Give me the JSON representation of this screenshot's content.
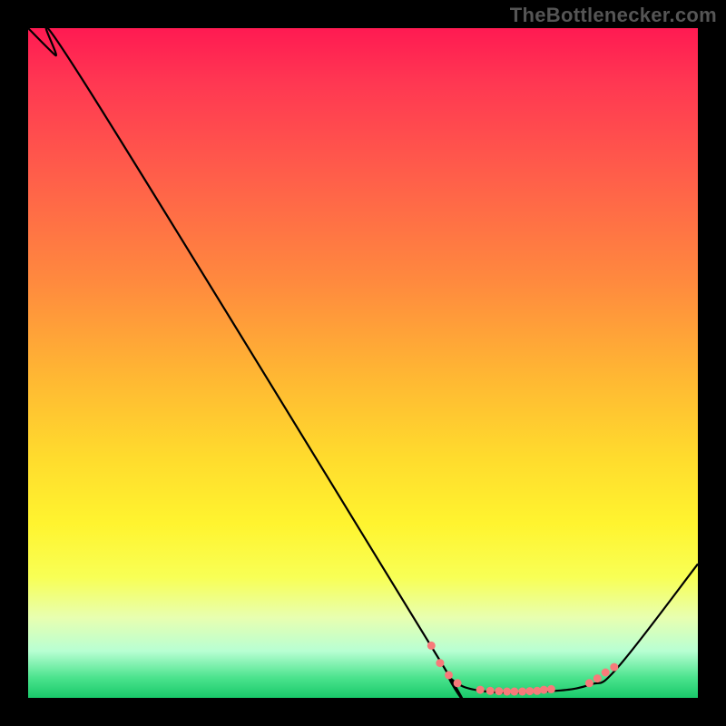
{
  "attribution": "TheBottlenecker.com",
  "chart_data": {
    "type": "line",
    "title": "",
    "xlabel": "",
    "ylabel": "",
    "xlim": [
      0,
      100
    ],
    "ylim": [
      0,
      100
    ],
    "curve": [
      {
        "x": 0,
        "y": 100
      },
      {
        "x": 4,
        "y": 96
      },
      {
        "x": 8,
        "y": 92.5
      },
      {
        "x": 60,
        "y": 8
      },
      {
        "x": 63,
        "y": 3
      },
      {
        "x": 68,
        "y": 1
      },
      {
        "x": 78,
        "y": 1
      },
      {
        "x": 84,
        "y": 2
      },
      {
        "x": 88,
        "y": 4.5
      },
      {
        "x": 100,
        "y": 20
      }
    ],
    "dots": [
      {
        "x": 60.2,
        "y": 7.8
      },
      {
        "x": 61.5,
        "y": 5.2
      },
      {
        "x": 62.8,
        "y": 3.4
      },
      {
        "x": 64.1,
        "y": 2.2
      },
      {
        "x": 67.5,
        "y": 1.2
      },
      {
        "x": 69.0,
        "y": 1.05
      },
      {
        "x": 70.3,
        "y": 1.0
      },
      {
        "x": 71.5,
        "y": 0.95
      },
      {
        "x": 72.6,
        "y": 0.95
      },
      {
        "x": 73.8,
        "y": 0.95
      },
      {
        "x": 74.9,
        "y": 1.0
      },
      {
        "x": 76.0,
        "y": 1.05
      },
      {
        "x": 77.0,
        "y": 1.2
      },
      {
        "x": 78.1,
        "y": 1.3
      },
      {
        "x": 83.8,
        "y": 2.2
      },
      {
        "x": 85.0,
        "y": 2.9
      },
      {
        "x": 86.2,
        "y": 3.8
      },
      {
        "x": 87.5,
        "y": 4.6
      }
    ],
    "dot_color": "#f77a7a",
    "curve_color": "#000000"
  }
}
